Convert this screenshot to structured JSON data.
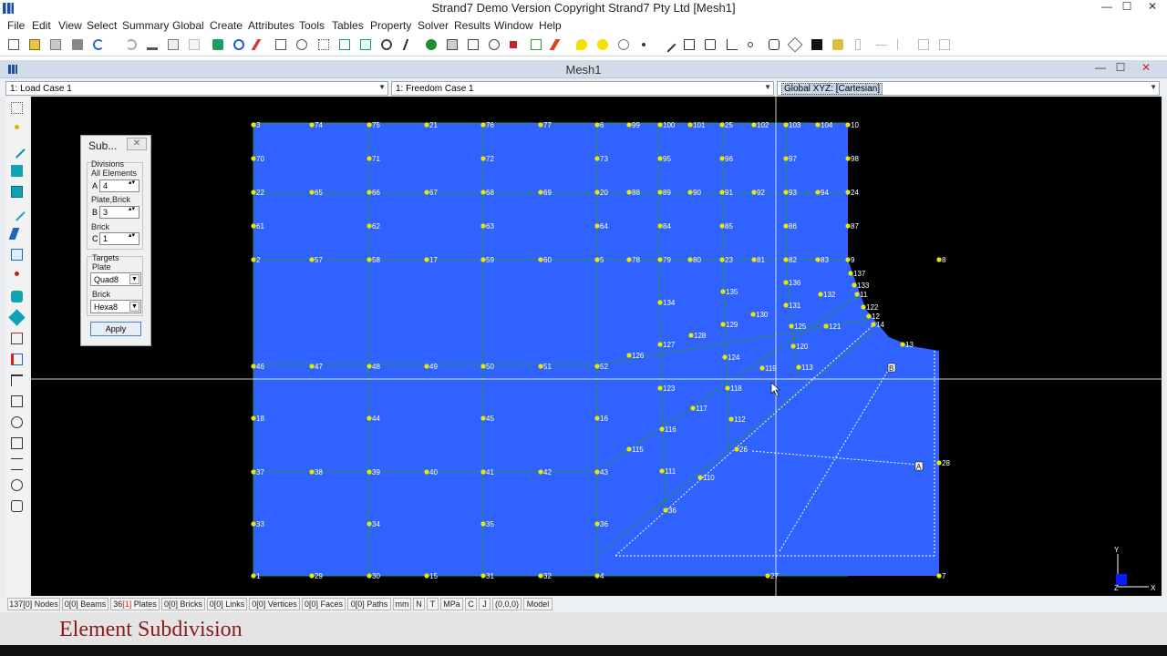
{
  "app": {
    "title": "Strand7 Demo Version Copyright Strand7 Pty Ltd [Mesh1]",
    "window_controls": [
      "—",
      "☐",
      "✕"
    ]
  },
  "menu": [
    "File",
    "Edit",
    "View",
    "Select",
    "Summary",
    "Global",
    "Create",
    "Attributes",
    "Tools",
    "Tables",
    "Property",
    "Solver",
    "Results",
    "Window",
    "Help"
  ],
  "mdi": {
    "title": "Mesh1",
    "controls": [
      "—",
      "☐",
      "✕"
    ]
  },
  "combos": {
    "load_case": "1: Load Case 1",
    "freedom_case": "1: Freedom Case 1",
    "coord_system": "Global XYZ: [Cartesian]",
    "arrow": "▼"
  },
  "subdivide_panel": {
    "title": "Sub...",
    "close": "✕",
    "divisions_label": "Divisions",
    "all_elements_label": "All Elements",
    "a_label": "A",
    "a_value": "4",
    "plate_brick_label": "Plate,Brick",
    "b_label": "B",
    "b_value": "3",
    "brick_label": "Brick",
    "c_label": "C",
    "c_value": "1",
    "spin_arrows": "▴▾",
    "targets_label": "Targets",
    "plate_label": "Plate",
    "plate_target": "Quad8",
    "brick_target_label": "Brick",
    "brick_target": "Hexa8",
    "dd_arrow": "▼",
    "apply_label": "Apply"
  },
  "model": {
    "node_labels": [
      "3",
      "74",
      "75",
      "21",
      "76",
      "77",
      "6",
      "99",
      "100",
      "101",
      "25",
      "102",
      "103",
      "104",
      "10",
      "70",
      "71",
      "72",
      "73",
      "95",
      "96",
      "97",
      "98",
      "22",
      "65",
      "66",
      "67",
      "68",
      "69",
      "20",
      "88",
      "89",
      "90",
      "91",
      "92",
      "93",
      "94",
      "24",
      "61",
      "62",
      "63",
      "64",
      "84",
      "85",
      "86",
      "87",
      "2",
      "57",
      "58",
      "17",
      "59",
      "60",
      "5",
      "78",
      "79",
      "80",
      "23",
      "81",
      "82",
      "83",
      "9",
      "8",
      "137",
      "133",
      "11",
      "136",
      "132",
      "122",
      "134",
      "135",
      "131",
      "12",
      "14",
      "130",
      "125",
      "121",
      "129",
      "13",
      "128",
      "127",
      "120",
      "126",
      "124",
      "119",
      "113",
      "46",
      "47",
      "48",
      "49",
      "50",
      "51",
      "52",
      "123",
      "118",
      "117",
      "112",
      "116",
      "18",
      "44",
      "45",
      "16",
      "115",
      "26",
      "37",
      "38",
      "39",
      "40",
      "41",
      "42",
      "43",
      "111",
      "28",
      "110",
      "33",
      "34",
      "35",
      "36",
      "1",
      "29",
      "30",
      "15",
      "31",
      "32",
      "4",
      "27",
      "7",
      "36"
    ],
    "line_labels": [
      "A",
      "B"
    ],
    "triad": {
      "y": "Y",
      "x": "X",
      "z": "Z"
    }
  },
  "status": {
    "nodes": "137[0] Nodes",
    "beams": "0[0] Beams",
    "plates_prefix": "36",
    "plates_sel": "[1]",
    "plates_suffix": " Plates",
    "bricks": "0[0] Bricks",
    "links": "0[0] Links",
    "vertices": "0[0] Vertices",
    "faces": "0[0] Faces",
    "paths": "0[0] Paths",
    "units_length": "mm",
    "units_force": "N",
    "units_temp": "T",
    "units_stress": "MPa",
    "units_c": "C",
    "units_j": "J",
    "cursor": "(0,0,0)",
    "mode": "Model"
  },
  "caption": "Element Subdivision",
  "colors": {
    "plate_fill": "#2f62ff",
    "node": "#e8e800",
    "background": "#000000",
    "caption": "#8b1a1a"
  }
}
